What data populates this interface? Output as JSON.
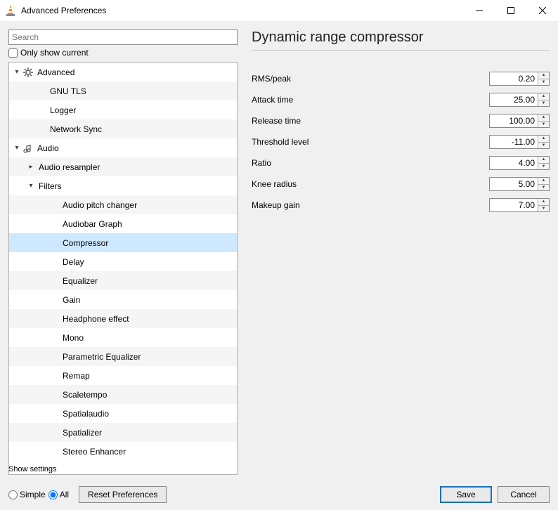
{
  "window": {
    "title": "Advanced Preferences"
  },
  "search": {
    "placeholder": "Search"
  },
  "only_show_current": {
    "label": "Only show current",
    "checked": false
  },
  "tree": [
    {
      "label": "Advanced",
      "level": 0,
      "caret": "down",
      "icon": "gear",
      "alt": false
    },
    {
      "label": "GNU TLS",
      "level": 2,
      "alt": true
    },
    {
      "label": "Logger",
      "level": 2,
      "alt": false
    },
    {
      "label": "Network Sync",
      "level": 2,
      "alt": true
    },
    {
      "label": "Audio",
      "level": 0,
      "caret": "down",
      "icon": "audio",
      "alt": false
    },
    {
      "label": "Audio resampler",
      "level": 1,
      "caret": "right",
      "alt": true
    },
    {
      "label": "Filters",
      "level": 1,
      "caret": "down",
      "alt": false
    },
    {
      "label": "Audio pitch changer",
      "level": 3,
      "alt": true
    },
    {
      "label": "Audiobar Graph",
      "level": 3,
      "alt": false
    },
    {
      "label": "Compressor",
      "level": 3,
      "alt": true,
      "selected": true
    },
    {
      "label": "Delay",
      "level": 3,
      "alt": false
    },
    {
      "label": "Equalizer",
      "level": 3,
      "alt": true
    },
    {
      "label": "Gain",
      "level": 3,
      "alt": false
    },
    {
      "label": "Headphone effect",
      "level": 3,
      "alt": true
    },
    {
      "label": "Mono",
      "level": 3,
      "alt": false
    },
    {
      "label": "Parametric Equalizer",
      "level": 3,
      "alt": true
    },
    {
      "label": "Remap",
      "level": 3,
      "alt": false
    },
    {
      "label": "Scaletempo",
      "level": 3,
      "alt": true
    },
    {
      "label": "Spatialaudio",
      "level": 3,
      "alt": false
    },
    {
      "label": "Spatializer",
      "level": 3,
      "alt": true
    },
    {
      "label": "Stereo Enhancer",
      "level": 3,
      "alt": false
    }
  ],
  "panel": {
    "title": "Dynamic range compressor",
    "fields": [
      {
        "label": "RMS/peak",
        "value": "0.20"
      },
      {
        "label": "Attack time",
        "value": "25.00"
      },
      {
        "label": "Release time",
        "value": "100.00"
      },
      {
        "label": "Threshold level",
        "value": "-11.00"
      },
      {
        "label": "Ratio",
        "value": "4.00"
      },
      {
        "label": "Knee radius",
        "value": "5.00"
      },
      {
        "label": "Makeup gain",
        "value": "7.00"
      }
    ]
  },
  "footer": {
    "show_settings_label": "Show settings",
    "simple_label": "Simple",
    "all_label": "All",
    "selected_mode": "all",
    "reset_label": "Reset Preferences",
    "save_label": "Save",
    "cancel_label": "Cancel"
  }
}
